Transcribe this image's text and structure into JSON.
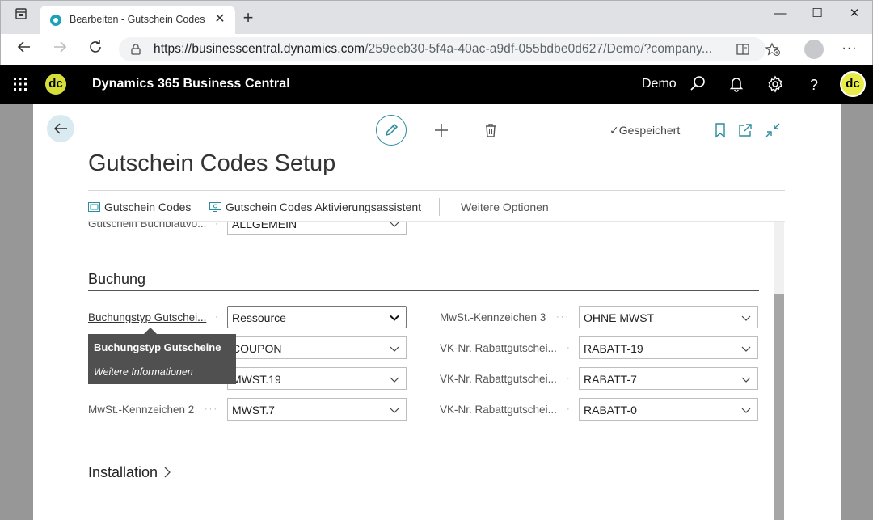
{
  "browser": {
    "tab_title": "Bearbeiten - Gutschein Codes Se",
    "url_host": "https://businesscentral.dynamics.com",
    "url_path": "/259eeb30-5f4a-40ac-a9df-055bdbe0d627/Demo/?company..."
  },
  "appbar": {
    "title": "Dynamics 365 Business Central",
    "company": "Demo",
    "avatar_initials": "dc"
  },
  "page": {
    "status": "Gespeichert",
    "title": "Gutschein Codes Setup",
    "actions": [
      "Gutschein Codes",
      "Gutschein Codes Aktivierungsassistent",
      "Weitere Optionen"
    ]
  },
  "fields": {
    "journal_label": "Gutschein Buchblattvo...",
    "journal_value": "ALLGEMEIN",
    "buchung_title": "Buchung",
    "posting_type_label": "Buchungstyp Gutschei...",
    "posting_type_value": "Ressource",
    "coupon_value": "COUPON",
    "mwst19_value": "MWST.19",
    "mwst2_label": "MwSt.-Kennzeichen 2",
    "mwst2_value": "MWST.7",
    "mwst3_label": "MwSt.-Kennzeichen 3",
    "mwst3_value": "OHNE MWST",
    "vk1_label": "VK-Nr. Rabattgutschei...",
    "vk1_value": "RABATT-19",
    "vk2_label": "VK-Nr. Rabattgutschei...",
    "vk2_value": "RABATT-7",
    "vk3_label": "VK-Nr. Rabattgutschei...",
    "vk3_value": "RABATT-0",
    "installation_title": "Installation"
  },
  "tooltip": {
    "title": "Buchungstyp Gutscheine",
    "link": "Weitere Informationen"
  }
}
